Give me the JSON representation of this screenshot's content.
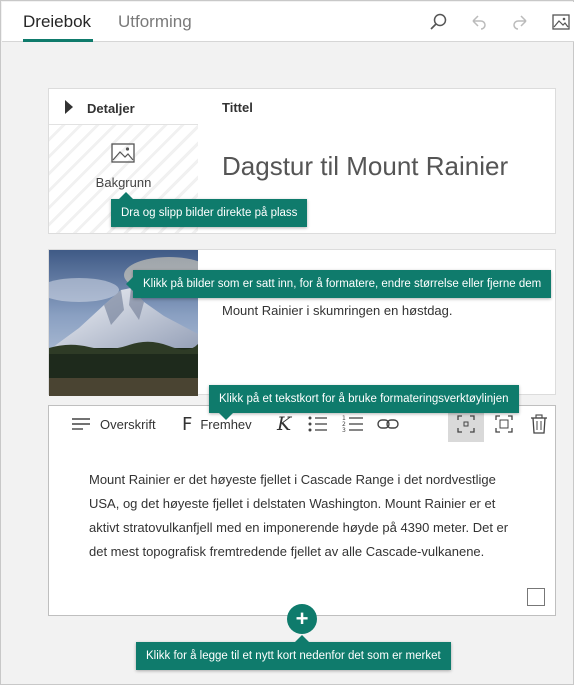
{
  "tabs": [
    {
      "label": "Dreiebok"
    },
    {
      "label": "Utforming"
    }
  ],
  "toolbar_icons": [
    "search-icon",
    "undo-icon",
    "redo-icon",
    "image-icon"
  ],
  "title_card": {
    "details_label": "Detaljer",
    "background_label": "Bakgrunn",
    "title_label": "Tittel",
    "title_text": "Dagstur til Mount Rainier"
  },
  "image_card": {
    "caption": "Mount Rainier i skumringen en høstdag."
  },
  "text_card": {
    "tools": {
      "heading": "Overskrift",
      "emphasis": "Fremhev"
    },
    "body": "Mount Rainier er det høyeste fjellet i Cascade Range i det nordvestlige USA, og det høyeste fjellet i delstaten Washington. Mount Rainier er et aktivt stratovulkanfjell med en imponerende høyde på 4390 meter. Det er det mest topografisk fremtredende fjellet av alle Cascade-vulkanene."
  },
  "tooltips": {
    "drag_images": "Dra og slipp bilder direkte på plass",
    "click_images": "Klikk på bilder som er satt inn, for å formatere, endre størrelse eller fjerne dem",
    "click_text_card": "Klikk på et tekstkort for å bruke formateringsverktøylinjen",
    "add_card": "Klikk for å legge til et nytt kort nedenfor det som er merket"
  },
  "add_button_label": "+",
  "colors": {
    "accent": "#0f7b6c",
    "background": "#f2f2f2"
  }
}
